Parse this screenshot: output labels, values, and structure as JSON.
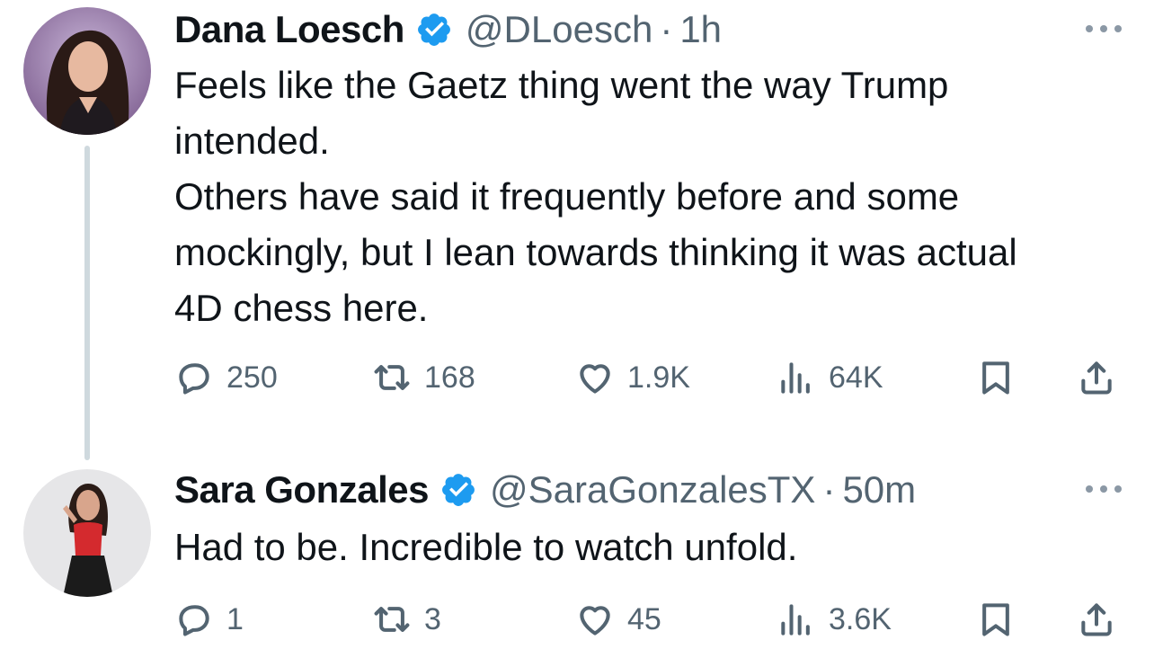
{
  "tweets": [
    {
      "author": "Dana Loesch",
      "handle": "@DLoesch",
      "time": "1h",
      "paragraphs": [
        "Feels like the Gaetz thing went the way Trump intended.",
        "Others have said it frequently before and some mockingly, but I lean towards thinking it was actual 4D chess here."
      ],
      "replies": "250",
      "retweets": "168",
      "likes": "1.9K",
      "views": "64K"
    },
    {
      "author": "Sara Gonzales",
      "handle": "@SaraGonzalesTX",
      "time": "50m",
      "paragraphs": [
        "Had to be. Incredible to watch unfold."
      ],
      "replies": "1",
      "retweets": "3",
      "likes": "45",
      "views": "3.6K"
    }
  ],
  "separator": "·",
  "icons": [
    "verified-badge-icon",
    "more-icon",
    "reply-icon",
    "retweet-icon",
    "like-icon",
    "views-icon",
    "bookmark-icon",
    "share-icon"
  ],
  "colors": {
    "verified": "#1d9bf0",
    "secondary_text": "#536471",
    "thread_line": "#cfd9de"
  }
}
